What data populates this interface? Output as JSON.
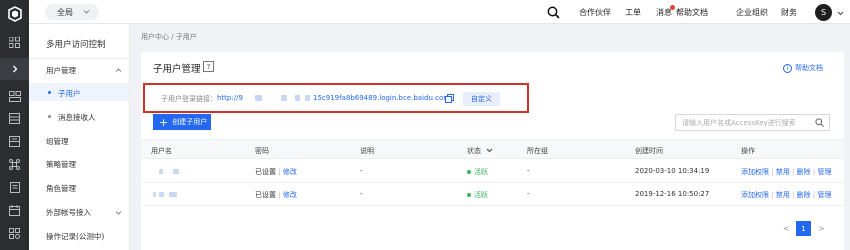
{
  "header": {
    "scope_label": "全局",
    "nav": [
      "合作伙伴",
      "工单",
      "消息",
      "帮助文档",
      "企业组织",
      "财务"
    ],
    "avatar_letter": "S"
  },
  "sidebar": {
    "title": "多用户访问控制",
    "items": [
      {
        "label": "用户管理"
      },
      {
        "label": "子用户"
      },
      {
        "label": "消息接收人"
      },
      {
        "label": "组管理"
      },
      {
        "label": "策略管理"
      },
      {
        "label": "角色管理"
      },
      {
        "label": "外部帐号接入"
      },
      {
        "label": "操作记录(公测中)"
      }
    ]
  },
  "breadcrumb": "用户中心 / 子用户",
  "page": {
    "title": "子用户管理",
    "question_mark": "?",
    "help_label": "帮助文档",
    "help_icon": "i"
  },
  "login": {
    "label": "子用户登录链接：",
    "url_prefix": "http://9",
    "url_suffix": "15c919fa8b69489.login.bce.baidu.com",
    "customize_label": "自定义"
  },
  "toolbar": {
    "create_label": "创建子用户",
    "search_placeholder": "请输入用户名或AccessKey进行搜索"
  },
  "table": {
    "columns": [
      "用户名",
      "密码",
      "说明",
      "状态",
      "所在组",
      "创建时间",
      "操作"
    ],
    "rows": [
      {
        "password": "已设置",
        "modify": "修改",
        "desc": "-",
        "status": "活跃",
        "group": "-",
        "created": "2020-03-10 10:34:19",
        "actions": [
          "添加权限",
          "禁用",
          "删除",
          "管理"
        ]
      },
      {
        "password": "已设置",
        "modify": "修改",
        "desc": "-",
        "status": "活跃",
        "group": "-",
        "created": "2019-12-16 10:50:27",
        "actions": [
          "添加权限",
          "禁用",
          "删除",
          "管理"
        ]
      }
    ]
  },
  "pagination": {
    "current": "1",
    "prev": "<",
    "next": ">"
  },
  "colors": {
    "accent": "#2468f2",
    "success": "#3cb35f",
    "highlight": "#d0322a",
    "rail": "#2b2d30"
  }
}
